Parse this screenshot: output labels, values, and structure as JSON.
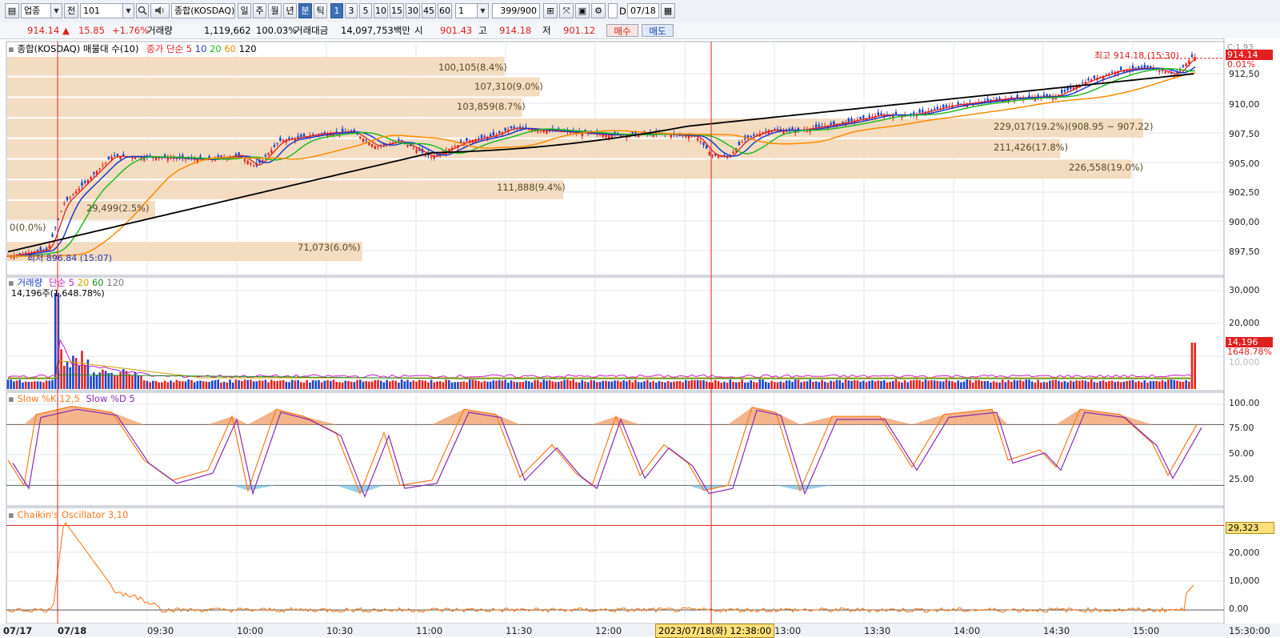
{
  "toolbar": {
    "market": "업종",
    "prev_label": "전",
    "code": "101",
    "search_icon": "search-icon",
    "speaker_icon": "speaker-icon",
    "index_name": "종합(KOSDAQ)",
    "period_buttons": [
      "일",
      "주",
      "월",
      "년",
      "분",
      "틱"
    ],
    "active_period": "분",
    "minute_buttons": [
      "1",
      "3",
      "5",
      "10",
      "15",
      "30",
      "45",
      "60"
    ],
    "active_minute": "1",
    "interval_value": "1",
    "count_value": "399",
    "count_total": "/900",
    "date_checkbox_label": "D",
    "date_value": "07/18",
    "calendar_icon": "calendar-icon"
  },
  "quote": {
    "price": "914.14",
    "arrow": "▲",
    "change": "15.85",
    "change_pct": "+1.76%",
    "volume_label": "거래량",
    "volume": "1,119,662",
    "volume_pct": "100.03%",
    "amount_label": "거래대금",
    "amount": "14,097,753백만",
    "open_label": "시",
    "open": "901.43",
    "high_label": "고",
    "high": "914.18",
    "low_label": "저",
    "low": "901.12",
    "buy_label": "매수",
    "sell_label": "매도"
  },
  "price_panel": {
    "title": "종합(KOSDAQ) 매물대 수(10)",
    "ma_label": "종가 단순",
    "ma_periods": [
      "5",
      "10",
      "20",
      "60",
      "120"
    ],
    "ma_colors": [
      "#e02020",
      "#1a3ccc",
      "#22bb22",
      "#ff8a00",
      "#000000"
    ],
    "y_ticks": [
      "912,50",
      "910,00",
      "907,50",
      "905,00",
      "902,50",
      "900,00",
      "897,50"
    ],
    "top_corner": "C:1.93",
    "current_price_tag": "914.14",
    "current_pct_tag": "0.01%",
    "high_annotation": "최고 914.18 (15:30)",
    "low_annotation": "최저 896.84 (15:07)",
    "volume_profile": [
      "100,105(8.4%)",
      "107,310(9.0%)",
      "103,859(8.7%)",
      "229,017(19.2%)(908.95 ~ 907.22)",
      "211,426(17.8%)",
      "226,558(19.0%)",
      "111,888(9.4%)",
      "29,499(2.5%)",
      "0(0.0%)",
      "71,073(6.0%)"
    ],
    "volume_profile_pct": [
      8.4,
      9.0,
      8.7,
      19.2,
      17.8,
      19.0,
      9.4,
      2.5,
      0.0,
      6.0
    ]
  },
  "volume_panel": {
    "title": "거래량",
    "ma_label": "단순",
    "ma_periods": [
      "5",
      "20",
      "60",
      "120"
    ],
    "sub_label": "14,196주(1,648.78%)",
    "y_ticks": [
      "30,000",
      "20,000",
      "10,000"
    ],
    "current_tag": "14,196",
    "current_pct_tag": "1648.78%"
  },
  "stoch_panel": {
    "title_k": "Slow %K 12,5",
    "title_d": "Slow %D 5",
    "y_ticks": [
      "100.00",
      "75.00",
      "50.00",
      "25.00"
    ]
  },
  "chaikin_panel": {
    "title": "Chaikin's Oscillator 3,10",
    "current_tag": "29,323",
    "y_ticks": [
      "20,000",
      "10,000",
      "0.00"
    ]
  },
  "x_axis": {
    "ticks": [
      "07/17",
      "07/18",
      "09:30",
      "10:00",
      "10:30",
      "11:00",
      "11:30",
      "12:00",
      "13:00",
      "13:30",
      "14:00",
      "14:30",
      "15:00",
      "15:30:00"
    ],
    "crosshair_label": "2023/07/18(화) 12:38:00"
  },
  "colors": {
    "up": "#e8231c",
    "down": "#1c46c8",
    "profile_band": "#f3dcc0",
    "stoch_k": "#ff7a1c",
    "stoch_d": "#8a2bb0",
    "chaikin": "#ff7a1c",
    "crosshair": "#e02020"
  }
}
